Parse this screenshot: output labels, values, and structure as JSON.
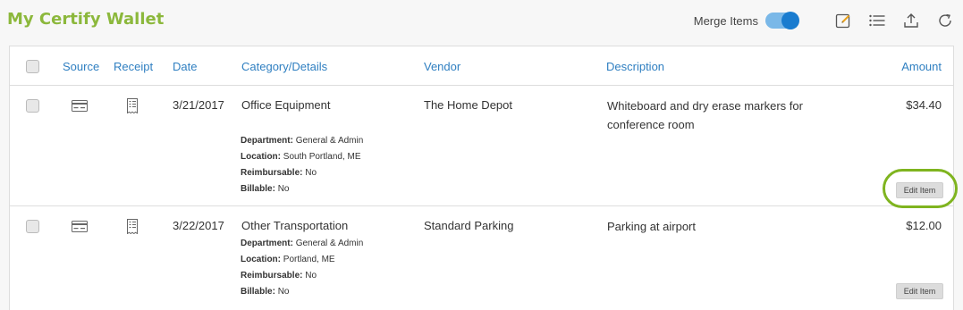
{
  "app": {
    "title": "My Certify Wallet",
    "merge_label": "Merge Items",
    "merge_on": true,
    "accent_color": "#8cb83c",
    "link_color": "#2f7fc1",
    "highlight_color": "#7fb41f",
    "toolbar_icons": [
      "edit-icon",
      "list-icon",
      "upload-icon",
      "refresh-icon"
    ]
  },
  "table": {
    "headers": {
      "source": "Source",
      "receipt": "Receipt",
      "date": "Date",
      "category": "Category/Details",
      "vendor": "Vendor",
      "description": "Description",
      "amount": "Amount"
    },
    "rows": [
      {
        "source_icon": "credit-card-icon",
        "receipt_icon": "receipt-icon",
        "date": "3/21/2017",
        "category": "Office Equipment",
        "department_label": "Department:",
        "department": "General & Admin",
        "location_label": "Location:",
        "location": "South Portland, ME",
        "reimbursable_label": "Reimbursable:",
        "reimbursable": "No",
        "billable_label": "Billable:",
        "billable": "No",
        "vendor": "The Home Depot",
        "description": "Whiteboard and dry erase markers for conference room",
        "amount": "$34.40",
        "edit_label": "Edit Item"
      },
      {
        "source_icon": "credit-card-icon",
        "receipt_icon": "receipt-icon",
        "date": "3/22/2017",
        "category": "Other Transportation",
        "department_label": "Department:",
        "department": "General & Admin",
        "location_label": "Location:",
        "location": "Portland, ME",
        "reimbursable_label": "Reimbursable:",
        "reimbursable": "No",
        "billable_label": "Billable:",
        "billable": "No",
        "vendor": "Standard Parking",
        "description": "Parking at airport",
        "amount": "$12.00",
        "edit_label": "Edit Item"
      }
    ]
  }
}
